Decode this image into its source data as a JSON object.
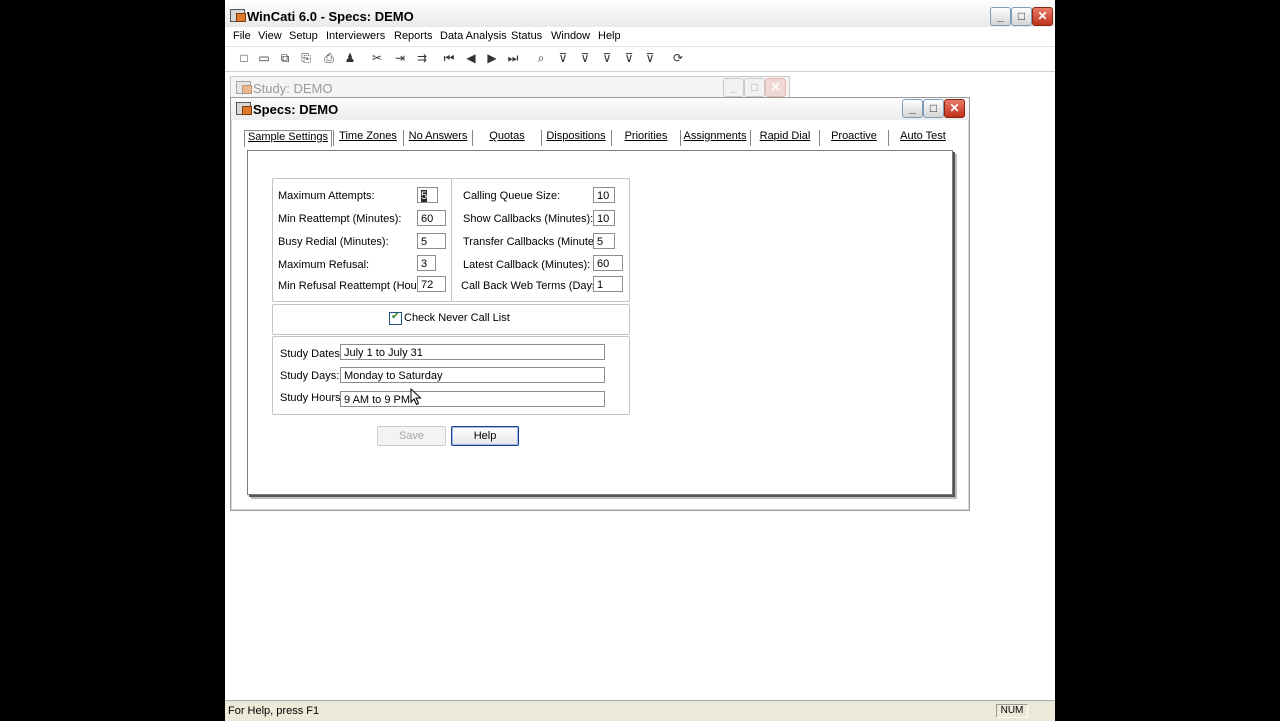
{
  "app": {
    "title": "WinCati 6.0 - Specs: DEMO"
  },
  "menu": [
    "File",
    "View",
    "Setup",
    "Interviewers",
    "Reports",
    "Data Analysis",
    "Status",
    "Window",
    "Help"
  ],
  "background_window": {
    "title": "Study: DEMO"
  },
  "specs_window": {
    "title": "Specs: DEMO"
  },
  "tabs": [
    "Sample Settings",
    "Time Zones",
    "No Answers",
    "Quotas",
    "Dispositions",
    "Priorities",
    "Assignments",
    "Rapid Dial",
    "Proactive",
    "Auto Test"
  ],
  "active_tab": "Sample Settings",
  "left_fields": [
    {
      "label": "Maximum Attempts:",
      "value": "5"
    },
    {
      "label": "Min Reattempt (Minutes):",
      "value": "60"
    },
    {
      "label": "Busy Redial (Minutes):",
      "value": "5"
    },
    {
      "label": "Maximum Refusal:",
      "value": "3"
    },
    {
      "label": "Min Refusal Reattempt (Hours):",
      "value": "72"
    }
  ],
  "right_fields": [
    {
      "label": "Calling Queue Size:",
      "value": "10"
    },
    {
      "label": "Show Callbacks (Minutes):",
      "value": "10"
    },
    {
      "label": "Transfer Callbacks (Minutes):",
      "value": "5"
    },
    {
      "label": "Latest Callback (Minutes):",
      "value": "60"
    },
    {
      "label": "Call Back Web Terms (Days):",
      "value": "1"
    }
  ],
  "check_never_call": {
    "label": "Check Never Call List",
    "checked": true
  },
  "study_fields": [
    {
      "label": "Study Dates:",
      "value": "July 1 to July 31"
    },
    {
      "label": "Study Days:",
      "value": "Monday to Saturday"
    },
    {
      "label": "Study Hours:",
      "value": "9 AM to 9 PM"
    }
  ],
  "buttons": {
    "save": "Save",
    "help": "Help"
  },
  "status": {
    "message": "For Help, press F1",
    "num": "NUM"
  }
}
